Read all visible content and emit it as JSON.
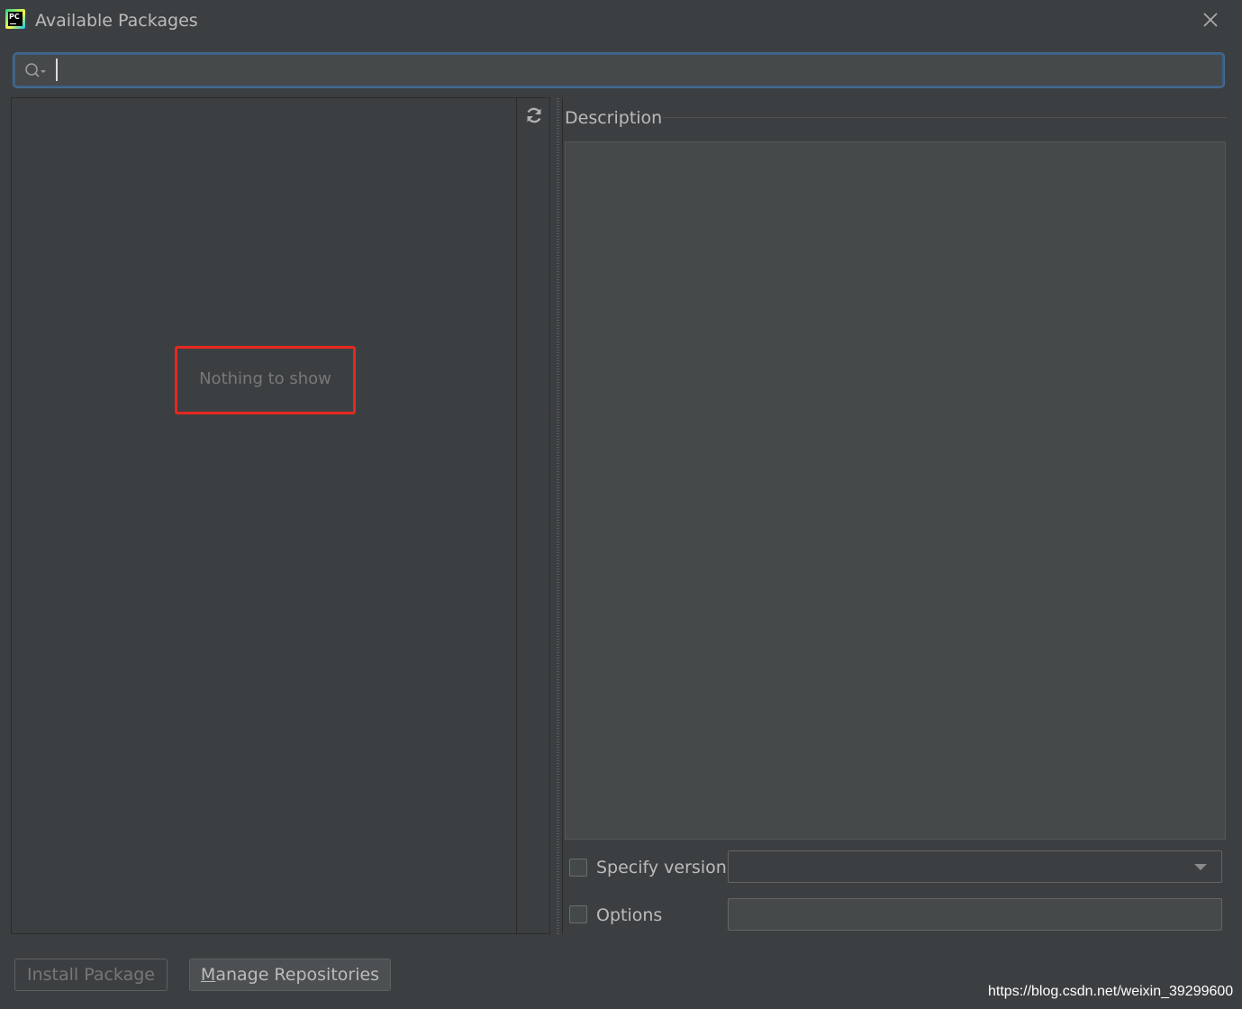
{
  "window": {
    "title": "Available Packages",
    "logo_text": "PC"
  },
  "search": {
    "value": "",
    "placeholder": ""
  },
  "package_list": {
    "empty_text": "Nothing to show",
    "items": []
  },
  "description": {
    "label": "Description",
    "content": ""
  },
  "options": {
    "specify_version_label": "Specify version",
    "specify_version_checked": false,
    "version_selected": "",
    "options_label": "Options",
    "options_checked": false,
    "options_value": ""
  },
  "buttons": {
    "install_label": "Install Package",
    "manage_label_mnemonic": "M",
    "manage_label_rest": "anage Repositories"
  },
  "watermark": "https://blog.csdn.net/weixin_39299600",
  "colors": {
    "background": "#3c3f41",
    "field": "#45494a",
    "focus_border": "#3d6185",
    "highlight": "#e52821",
    "text": "#bbbbbb"
  },
  "icons": [
    "pycharm-logo-icon",
    "close-icon",
    "search-icon",
    "refresh-icon",
    "chevron-down-icon"
  ]
}
